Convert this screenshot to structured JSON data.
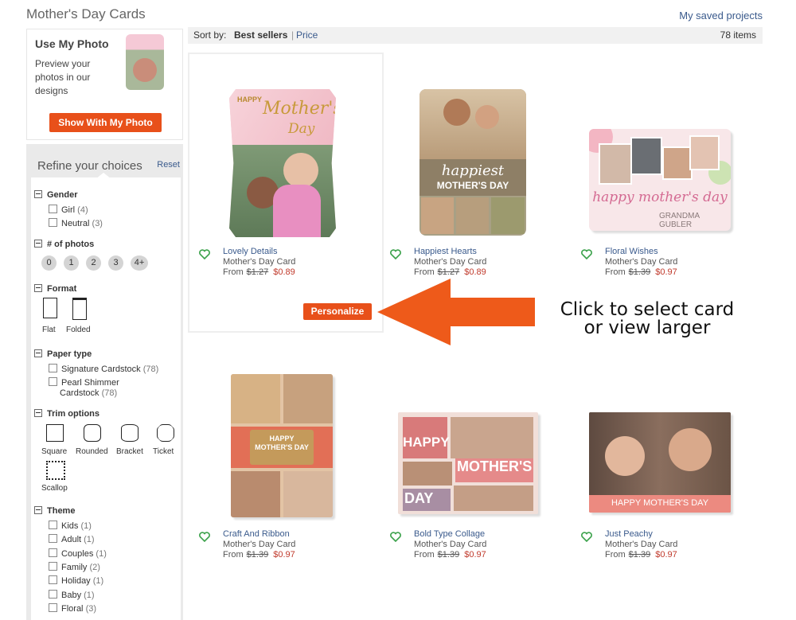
{
  "header": {
    "title": "Mother's Day Cards",
    "saved_projects": "My saved projects"
  },
  "use_photo": {
    "heading": "Use My Photo",
    "description": "Preview your photos in our designs",
    "button": "Show With My Photo"
  },
  "sortbar": {
    "label": "Sort by:",
    "best": "Best sellers",
    "separator": "|",
    "price": "Price",
    "count": "78 items"
  },
  "refine": {
    "title": "Refine your choices",
    "reset": "Reset",
    "gender": {
      "label": "Gender",
      "options": [
        {
          "label": "Girl",
          "count": "(4)"
        },
        {
          "label": "Neutral",
          "count": "(3)"
        }
      ]
    },
    "photos": {
      "label": "# of photos",
      "options": [
        "0",
        "1",
        "2",
        "3",
        "4+"
      ]
    },
    "format": {
      "label": "Format",
      "options": [
        "Flat",
        "Folded"
      ]
    },
    "paper": {
      "label": "Paper type",
      "options": [
        {
          "label": "Signature Cardstock",
          "count": "(78)"
        },
        {
          "label": "Pearl Shimmer",
          "label2": "Cardstock",
          "count": "(78)"
        }
      ]
    },
    "trim": {
      "label": "Trim options",
      "options": [
        "Square",
        "Rounded",
        "Bracket",
        "Ticket",
        "Scallop"
      ]
    },
    "theme": {
      "label": "Theme",
      "options": [
        {
          "label": "Kids",
          "count": "(1)"
        },
        {
          "label": "Adult",
          "count": "(1)"
        },
        {
          "label": "Couples",
          "count": "(1)"
        },
        {
          "label": "Family",
          "count": "(2)"
        },
        {
          "label": "Holiday",
          "count": "(1)"
        },
        {
          "label": "Baby",
          "count": "(1)"
        },
        {
          "label": "Floral",
          "count": "(3)"
        }
      ]
    }
  },
  "products": [
    {
      "name": "Lovely Details",
      "type": "Mother's Day Card",
      "from": "From",
      "old": "$1.27",
      "new": "$0.89"
    },
    {
      "name": "Happiest Hearts",
      "type": "Mother's Day Card",
      "from": "From",
      "old": "$1.27",
      "new": "$0.89"
    },
    {
      "name": "Floral Wishes",
      "type": "Mother's Day Card",
      "from": "From",
      "old": "$1.39",
      "new": "$0.97"
    },
    {
      "name": "Craft And Ribbon",
      "type": "Mother's Day Card",
      "from": "From",
      "old": "$1.39",
      "new": "$0.97"
    },
    {
      "name": "Bold Type Collage",
      "type": "Mother's Day Card",
      "from": "From",
      "old": "$1.39",
      "new": "$0.97"
    },
    {
      "name": "Just Peachy",
      "type": "Mother's Day Card",
      "from": "From",
      "old": "$1.39",
      "new": "$0.97"
    }
  ],
  "card_text": {
    "c1_happy": "HAPPY",
    "c1_mothers": "Mother's",
    "c1_day": "Day",
    "c2_happiest": "happiest",
    "c2_mothers": "MOTHER'S DAY",
    "c3_text": "happy mother's day",
    "c3_sub": "GRANDMA GUBLER",
    "c4_text": "HAPPY MOTHER'S DAY",
    "c5_happy": "HAPPY",
    "c5_mothers": "MOTHER'S",
    "c5_day": "DAY",
    "c6_text": "HAPPY MOTHER'S DAY"
  },
  "personalize": "Personalize",
  "callout": "Click to select card or view larger",
  "colors": {
    "accent": "#e8501a",
    "link": "#3a5a8c",
    "heart": "#3aa14a",
    "sale": "#c0392b"
  }
}
